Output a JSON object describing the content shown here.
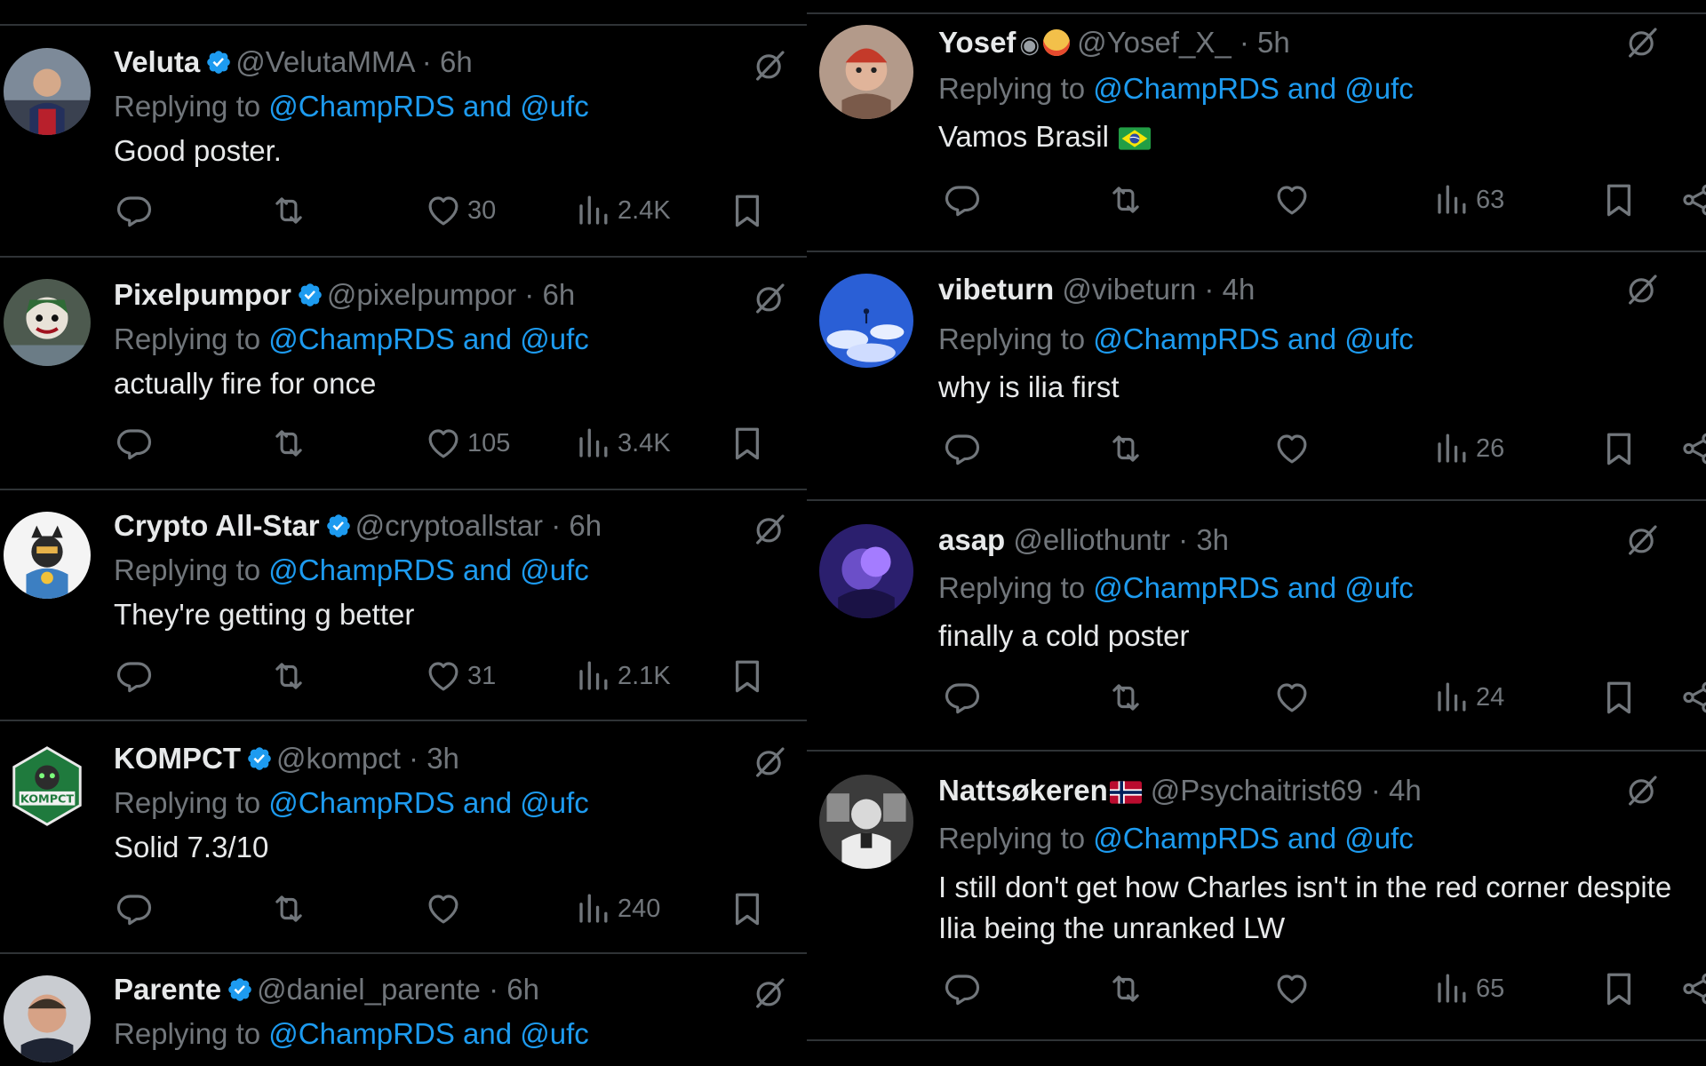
{
  "reply_prefix": "Replying to",
  "left_column": [
    {
      "name": "Veluta",
      "handle": "@VelutaMMA",
      "time": "6h",
      "verified": true,
      "reply_to": "@ChampRDS and @ufc",
      "text": "Good poster.",
      "likes": "30",
      "views": "2.4K"
    },
    {
      "name": "Pixelpumpor",
      "handle": "@pixelpumpor",
      "time": "6h",
      "verified": true,
      "reply_to": "@ChampRDS and @ufc",
      "text": "actually fire for once",
      "likes": "105",
      "views": "3.4K"
    },
    {
      "name": "Crypto All-Star",
      "handle": "@cryptoallstar",
      "time": "6h",
      "verified": true,
      "reply_to": "@ChampRDS and @ufc",
      "text": "They're getting g better",
      "likes": "31",
      "views": "2.1K"
    },
    {
      "name": "KOMPCT",
      "handle": "@kompct",
      "time": "3h",
      "verified": true,
      "reply_to": "@ChampRDS and @ufc",
      "text": "Solid 7.3/10",
      "likes": "",
      "views": "240"
    },
    {
      "name": "Parente",
      "handle": "@daniel_parente",
      "time": "6h",
      "verified": true,
      "reply_to": "@ChampRDS and @ufc",
      "text": "",
      "likes": "",
      "views": ""
    }
  ],
  "right_column": [
    {
      "name": "Yosef",
      "handle": "@Yosef_X_",
      "time": "5h",
      "reply_to": "@ChampRDS and @ufc",
      "text": "Vamos Brasil",
      "views": "63"
    },
    {
      "name": "vibeturn",
      "handle": "@vibeturn",
      "time": "4h",
      "reply_to": "@ChampRDS and @ufc",
      "text": "why is ilia first",
      "views": "26"
    },
    {
      "name": "asap",
      "handle": "@elliothuntr",
      "time": "3h",
      "reply_to": "@ChampRDS and @ufc",
      "text": "finally a cold poster",
      "views": "24"
    },
    {
      "name": "Nattsøkeren",
      "handle": "@Psychaitrist69",
      "time": "4h",
      "reply_to": "@ChampRDS and @ufc",
      "text": "I still don't get how Charles isn't in the red corner despite Ilia being the unranked LW",
      "views": "65"
    }
  ],
  "colors": {
    "background": "#000000",
    "text": "#e7e9ea",
    "muted": "#71767b",
    "link": "#1d9bf0",
    "divider": "#2f3336"
  },
  "icons": [
    "verified-badge-icon",
    "grok-icon",
    "reply-icon",
    "retweet-icon",
    "like-icon",
    "views-icon",
    "bookmark-icon",
    "share-icon",
    "brazil-flag-icon",
    "norway-flag-icon"
  ]
}
